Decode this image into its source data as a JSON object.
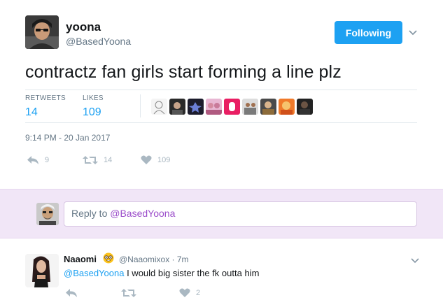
{
  "tweet": {
    "name": "yoona",
    "handle": "@BasedYoona",
    "follow_label": "Following",
    "text": "contractz fan girls start forming a line plz",
    "stats": {
      "retweets_label": "RETWEETS",
      "retweets_value": "14",
      "likes_label": "LIKES",
      "likes_value": "109"
    },
    "liker_avatars": [
      "avatar-1",
      "avatar-2",
      "avatar-3",
      "avatar-4",
      "avatar-5",
      "avatar-6",
      "avatar-7",
      "avatar-8",
      "avatar-9"
    ],
    "timestamp": "9:14 PM - 20 Jan 2017",
    "actions": {
      "reply_count": "9",
      "retweet_count": "14",
      "like_count": "109"
    }
  },
  "composer": {
    "prefix": "Reply to ",
    "mention": "@BasedYoona"
  },
  "reply": {
    "name": "Naaomi",
    "emoji_icon": "nerd-face-icon",
    "handle_time": "@Naaomixox · 7m",
    "mention": "@BasedYoona",
    "text": " I would big sister the fk outta him",
    "like_count": "2"
  },
  "colors": {
    "accent": "#1da1f2",
    "reply_bar_bg": "#f1e6f7",
    "muted": "#657786",
    "action_icon": "#aab8c2"
  }
}
